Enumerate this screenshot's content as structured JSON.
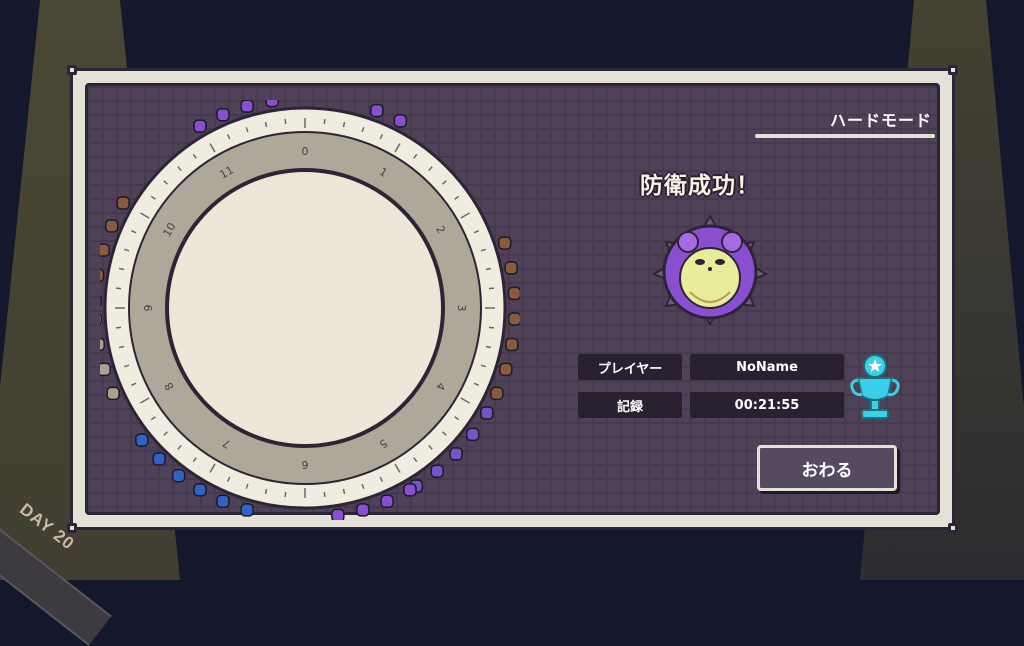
{
  "day_label": "DAY 20",
  "mode": "ハードモード",
  "result_title": "防衛成功！",
  "info": {
    "player_key": "プレイヤー",
    "player_value": "NoName",
    "record_key": "記録",
    "record_value": "00:21:55"
  },
  "end_button": "おわる",
  "clock_numbers": [
    "0",
    "1",
    "2",
    "3",
    "4",
    "5",
    "6",
    "7",
    "8",
    "9",
    "10",
    "11"
  ],
  "colors": {
    "accent_purple": "#8a4fd1",
    "mascot_yellow": "#e9ec9b",
    "trophy_cyan": "#3ad0e8",
    "panel_bg": "#4f4258"
  }
}
